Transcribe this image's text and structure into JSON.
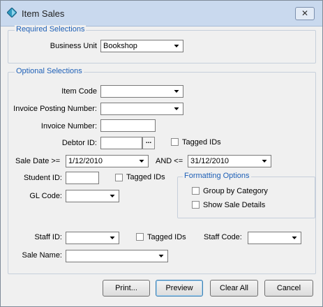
{
  "window": {
    "title": "Item Sales",
    "close_glyph": "✕"
  },
  "required": {
    "legend": "Required Selections",
    "business_unit": {
      "label": "Business Unit",
      "value": "Bookshop"
    }
  },
  "optional": {
    "legend": "Optional Selections",
    "item_code": {
      "label": "Item Code",
      "value": ""
    },
    "invoice_posting_number": {
      "label": "Invoice Posting Number:",
      "value": ""
    },
    "invoice_number": {
      "label": "Invoice Number:",
      "value": ""
    },
    "debtor_id": {
      "label": "Debtor ID:",
      "value": "",
      "ellipsis": "...",
      "tagged_label": "Tagged IDs"
    },
    "sale_date": {
      "label": "Sale Date >=",
      "from": "1/12/2010",
      "and_label": "AND <=",
      "to": "31/12/2010"
    },
    "student_id": {
      "label": "Student ID:",
      "value": "",
      "tagged_label": "Tagged IDs"
    },
    "gl_code": {
      "label": "GL Code:",
      "value": ""
    },
    "formatting": {
      "legend": "Formatting Options",
      "group_by_category": "Group by Category",
      "show_sale_details": "Show Sale Details"
    },
    "staff_id": {
      "label": "Staff ID:",
      "value": "",
      "tagged_label": "Tagged IDs"
    },
    "staff_code": {
      "label": "Staff Code:",
      "value": ""
    },
    "sale_name": {
      "label": "Sale Name:",
      "value": ""
    }
  },
  "buttons": {
    "print": "Print...",
    "preview": "Preview",
    "clear_all": "Clear All",
    "cancel": "Cancel"
  },
  "colors": {
    "legend_text": "#1d5fb6",
    "titlebar": "#c9d9ee"
  },
  "icons": {
    "app": "app-diamond-icon",
    "dropdown": "chevron-down-icon"
  }
}
